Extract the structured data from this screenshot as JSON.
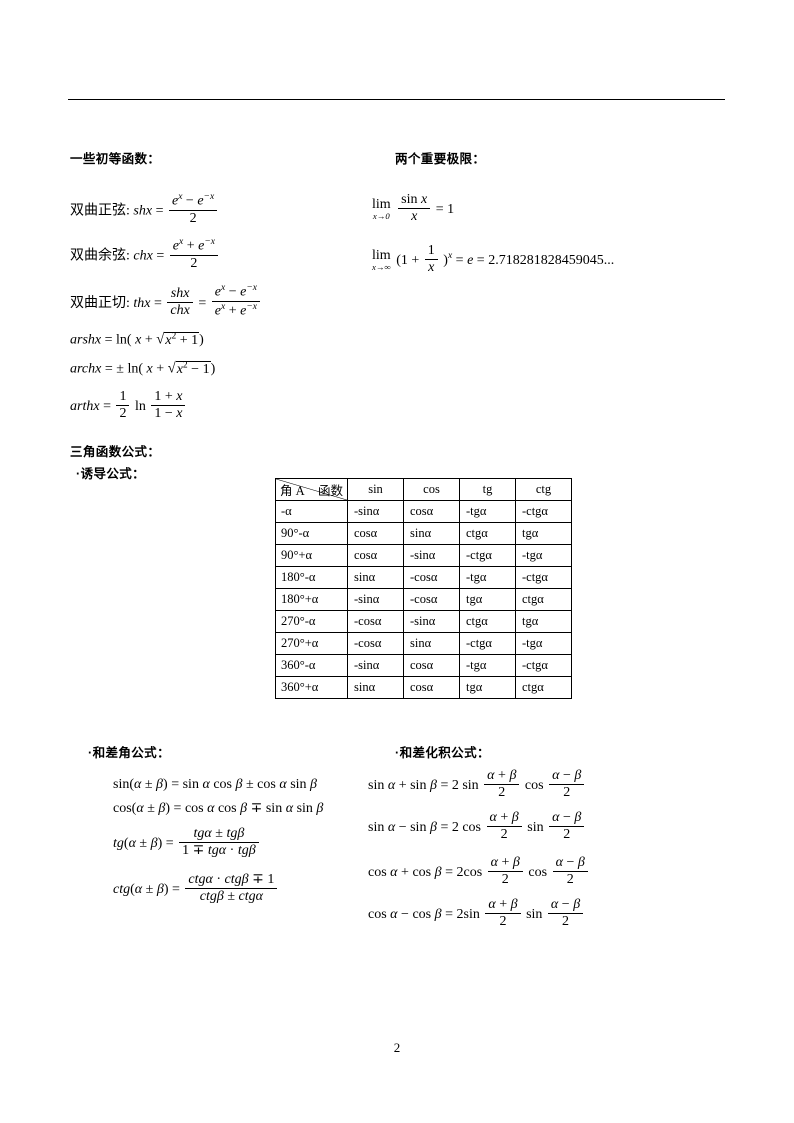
{
  "page": {
    "number": "2"
  },
  "sections": {
    "elementary_functions": {
      "heading": "一些初等函数：",
      "items": [
        {
          "label": "双曲正弦",
          "name": "shx"
        },
        {
          "label": "双曲余弦",
          "name": "chx"
        },
        {
          "label": "双曲正切",
          "name": "thx"
        }
      ],
      "inverse": [
        {
          "name": "arshx"
        },
        {
          "name": "archx"
        },
        {
          "name": "arthx"
        }
      ]
    },
    "important_limits": {
      "heading": "两个重要极限：",
      "limit1": {
        "lim": "lim",
        "sub": "x→0",
        "result": "1"
      },
      "limit2": {
        "lim": "lim",
        "sub": "x→∞",
        "e_value": "2.718281828459045..."
      }
    },
    "trig_formulas": {
      "heading": "三角函数公式：",
      "induction_heading": "·诱导公式：",
      "sum_diff_heading": "·和差角公式：",
      "product_heading": "·和差化积公式："
    }
  },
  "trig_table": {
    "corner": {
      "function_label": "函数",
      "angle_label": "角 A"
    },
    "columns": [
      "sin",
      "cos",
      "tg",
      "ctg"
    ],
    "rows": [
      {
        "angle": "-α",
        "values": [
          "-sinα",
          "cosα",
          "-tgα",
          "-ctgα"
        ]
      },
      {
        "angle": "90°-α",
        "values": [
          "cosα",
          "sinα",
          "ctgα",
          "tgα"
        ]
      },
      {
        "angle": "90°+α",
        "values": [
          "cosα",
          "-sinα",
          "-ctgα",
          "-tgα"
        ]
      },
      {
        "angle": "180°-α",
        "values": [
          "sinα",
          "-cosα",
          "-tgα",
          "-ctgα"
        ]
      },
      {
        "angle": "180°+α",
        "values": [
          "-sinα",
          "-cosα",
          "tgα",
          "ctgα"
        ]
      },
      {
        "angle": "270°-α",
        "values": [
          "-cosα",
          "-sinα",
          "ctgα",
          "tgα"
        ]
      },
      {
        "angle": "270°+α",
        "values": [
          "-cosα",
          "sinα",
          "-ctgα",
          "-tgα"
        ]
      },
      {
        "angle": "360°-α",
        "values": [
          "-sinα",
          "cosα",
          "-tgα",
          "-ctgα"
        ]
      },
      {
        "angle": "360°+α",
        "values": [
          "sinα",
          "cosα",
          "tgα",
          "ctgα"
        ]
      }
    ]
  },
  "formulas": {
    "sum_diff": [
      "sin(α±β) = sin α cos β ± cos α sin β",
      "cos(α±β) = cos α cos β ∓ sin α sin β",
      "tg(α±β) = (tgα ± tgβ) / (1 ∓ tgα·tgβ)",
      "ctg(α±β) = (ctgα·ctgβ ∓ 1) / (ctgβ ± ctgα)"
    ],
    "sum_to_product": [
      "sin α + sin β = 2 sin((α+β)/2) cos((α−β)/2)",
      "sin α − sin β = 2 cos((α+β)/2) sin((α−β)/2)",
      "cos α + cos β = 2 cos((α+β)/2) cos((α−β)/2)",
      "cos α − cos β = 2 sin((α+β)/2) sin((α−β)/2)"
    ]
  },
  "symbols": {
    "plus_minus": "±",
    "minus_plus": "∓",
    "equals": "=",
    "two": "2",
    "one": "1",
    "half_num": "1",
    "half_den": "2"
  }
}
